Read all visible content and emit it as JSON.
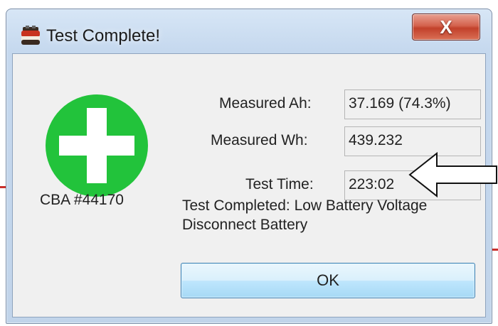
{
  "window": {
    "title": "Test Complete!",
    "close_label": "X"
  },
  "device": {
    "label": "CBA #44170"
  },
  "results": [
    {
      "label": "Measured Ah:",
      "value": "37.169 (74.3%)"
    },
    {
      "label": "Measured Wh:",
      "value": "439.232"
    },
    {
      "label": "Test Time:",
      "value": "223:02"
    }
  ],
  "status": {
    "line1": "Test Completed: Low Battery Voltage",
    "line2": "Disconnect Battery"
  },
  "ok_button": {
    "label": "OK"
  },
  "colors": {
    "plus_green": "#22c33b",
    "close_red": "#c2412b",
    "ok_blue": "#a7d9f5"
  },
  "icons": {
    "app": "battery-icon",
    "status": "plus-icon",
    "annotation": "arrow-left-icon"
  }
}
